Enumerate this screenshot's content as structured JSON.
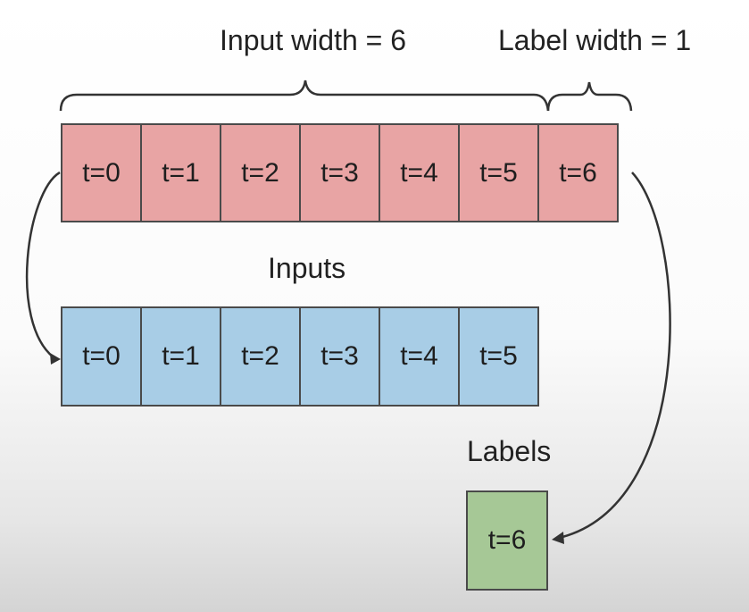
{
  "header": {
    "input_width_label": "Input width = 6",
    "label_width_label": "Label width = 1"
  },
  "window_row": {
    "cells": [
      "t=0",
      "t=1",
      "t=2",
      "t=3",
      "t=4",
      "t=5",
      "t=6"
    ]
  },
  "inputs": {
    "title": "Inputs",
    "cells": [
      "t=0",
      "t=1",
      "t=2",
      "t=3",
      "t=4",
      "t=5"
    ]
  },
  "labels": {
    "title": "Labels",
    "cells": [
      "t=6"
    ]
  },
  "colors": {
    "window_fill": "#e8a4a4",
    "inputs_fill": "#a8cde6",
    "labels_fill": "#a6c896",
    "border": "#4a4a4a"
  }
}
